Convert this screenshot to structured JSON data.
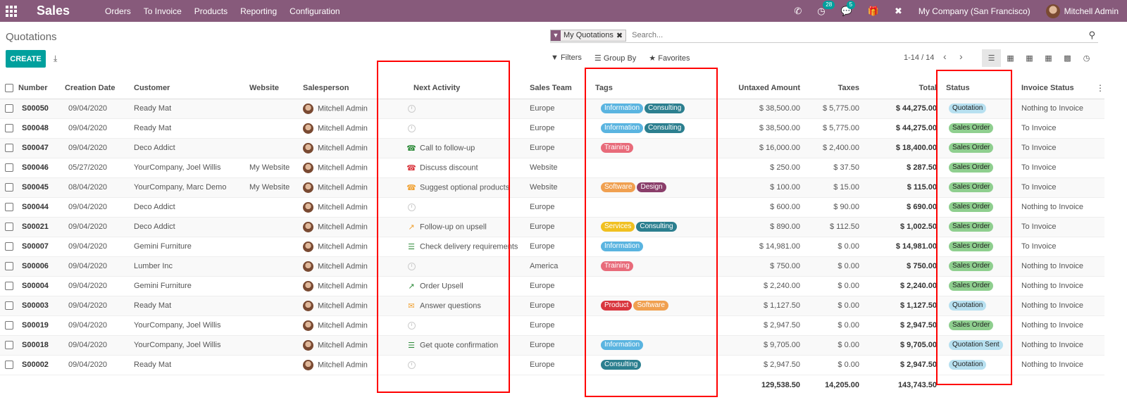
{
  "navbar": {
    "app_name": "Sales",
    "menu": [
      "Orders",
      "To Invoice",
      "Products",
      "Reporting",
      "Configuration"
    ],
    "activity_count": "28",
    "message_count": "5",
    "company": "My Company (San Francisco)",
    "user": "Mitchell Admin",
    "bg_color": "#875a7b"
  },
  "control": {
    "breadcrumb": "Quotations",
    "create_label": "CREATE",
    "facet_label": "My Quotations",
    "search_placeholder": "Search...",
    "filters_label": "Filters",
    "groupby_label": "Group By",
    "favorites_label": "Favorites",
    "pager": "1-14 / 14"
  },
  "columns": [
    "Number",
    "Creation Date",
    "Customer",
    "Website",
    "Salesperson",
    "Next Activity",
    "Sales Team",
    "Tags",
    "Untaxed Amount",
    "Taxes",
    "Total",
    "Status",
    "Invoice Status"
  ],
  "rows": [
    {
      "number": "S00050",
      "date": "09/04/2020",
      "customer": "Ready Mat",
      "website": "",
      "salesperson": "Mitchell Admin",
      "activity": "",
      "activity_icon": "clock-icon",
      "team": "Europe",
      "tags": [
        {
          "t": "Information",
          "c": "#5ab4e0"
        },
        {
          "t": "Consulting",
          "c": "#2c7f8f"
        }
      ],
      "untaxed": "$ 38,500.00",
      "taxes": "$ 5,775.00",
      "total": "$ 44,275.00",
      "status": "Quotation",
      "status_color": "#b7e0f0",
      "invoice": "Nothing to Invoice"
    },
    {
      "number": "S00048",
      "date": "09/04/2020",
      "customer": "Ready Mat",
      "website": "",
      "salesperson": "Mitchell Admin",
      "activity": "",
      "activity_icon": "clock-icon",
      "team": "Europe",
      "tags": [
        {
          "t": "Information",
          "c": "#5ab4e0"
        },
        {
          "t": "Consulting",
          "c": "#2c7f8f"
        }
      ],
      "untaxed": "$ 38,500.00",
      "taxes": "$ 5,775.00",
      "total": "$ 44,275.00",
      "status": "Sales Order",
      "status_color": "#8fcf8f",
      "invoice": "To Invoice"
    },
    {
      "number": "S00047",
      "date": "09/04/2020",
      "customer": "Deco Addict",
      "website": "",
      "salesperson": "Mitchell Admin",
      "activity": "Call to follow-up",
      "activity_icon": "phone-icon",
      "activity_color": "#2e8b3a",
      "team": "Europe",
      "tags": [
        {
          "t": "Training",
          "c": "#e86b7a"
        }
      ],
      "untaxed": "$ 16,000.00",
      "taxes": "$ 2,400.00",
      "total": "$ 18,400.00",
      "status": "Sales Order",
      "status_color": "#8fcf8f",
      "invoice": "To Invoice"
    },
    {
      "number": "S00046",
      "date": "05/27/2020",
      "customer": "YourCompany, Joel Willis",
      "website": "My Website",
      "salesperson": "Mitchell Admin",
      "activity": "Discuss discount",
      "activity_icon": "phone-icon",
      "activity_color": "#d9363e",
      "team": "Website",
      "tags": [],
      "untaxed": "$ 250.00",
      "taxes": "$ 37.50",
      "total": "$ 287.50",
      "status": "Sales Order",
      "status_color": "#8fcf8f",
      "invoice": "To Invoice"
    },
    {
      "number": "S00045",
      "date": "08/04/2020",
      "customer": "YourCompany, Marc Demo",
      "website": "My Website",
      "salesperson": "Mitchell Admin",
      "activity": "Suggest optional products",
      "activity_icon": "phone-icon",
      "activity_color": "#f0a030",
      "team": "Website",
      "tags": [
        {
          "t": "Software",
          "c": "#f0a050"
        },
        {
          "t": "Design",
          "c": "#8a3e6a"
        }
      ],
      "untaxed": "$ 100.00",
      "taxes": "$ 15.00",
      "total": "$ 115.00",
      "status": "Sales Order",
      "status_color": "#8fcf8f",
      "invoice": "To Invoice"
    },
    {
      "number": "S00044",
      "date": "09/04/2020",
      "customer": "Deco Addict",
      "website": "",
      "salesperson": "Mitchell Admin",
      "activity": "",
      "activity_icon": "clock-icon",
      "team": "Europe",
      "tags": [],
      "untaxed": "$ 600.00",
      "taxes": "$ 90.00",
      "total": "$ 690.00",
      "status": "Sales Order",
      "status_color": "#8fcf8f",
      "invoice": "Nothing to Invoice"
    },
    {
      "number": "S00021",
      "date": "09/04/2020",
      "customer": "Deco Addict",
      "website": "",
      "salesperson": "Mitchell Admin",
      "activity": "Follow-up on upsell",
      "activity_icon": "chart-icon",
      "activity_color": "#f0a030",
      "team": "Europe",
      "tags": [
        {
          "t": "Services",
          "c": "#f0c020"
        },
        {
          "t": "Consulting",
          "c": "#2c7f8f"
        }
      ],
      "untaxed": "$ 890.00",
      "taxes": "$ 112.50",
      "total": "$ 1,002.50",
      "status": "Sales Order",
      "status_color": "#8fcf8f",
      "invoice": "To Invoice"
    },
    {
      "number": "S00007",
      "date": "09/04/2020",
      "customer": "Gemini Furniture",
      "website": "",
      "salesperson": "Mitchell Admin",
      "activity": "Check delivery requirements",
      "activity_icon": "tasks-icon",
      "activity_color": "#2e8b3a",
      "team": "Europe",
      "tags": [
        {
          "t": "Information",
          "c": "#5ab4e0"
        }
      ],
      "untaxed": "$ 14,981.00",
      "taxes": "$ 0.00",
      "total": "$ 14,981.00",
      "status": "Sales Order",
      "status_color": "#8fcf8f",
      "invoice": "To Invoice"
    },
    {
      "number": "S00006",
      "date": "09/04/2020",
      "customer": "Lumber Inc",
      "website": "",
      "salesperson": "Mitchell Admin",
      "activity": "",
      "activity_icon": "clock-icon",
      "team": "America",
      "tags": [
        {
          "t": "Training",
          "c": "#e86b7a"
        }
      ],
      "untaxed": "$ 750.00",
      "taxes": "$ 0.00",
      "total": "$ 750.00",
      "status": "Sales Order",
      "status_color": "#8fcf8f",
      "invoice": "Nothing to Invoice"
    },
    {
      "number": "S00004",
      "date": "09/04/2020",
      "customer": "Gemini Furniture",
      "website": "",
      "salesperson": "Mitchell Admin",
      "activity": "Order Upsell",
      "activity_icon": "chart-icon",
      "activity_color": "#2e8b3a",
      "team": "Europe",
      "tags": [],
      "untaxed": "$ 2,240.00",
      "taxes": "$ 0.00",
      "total": "$ 2,240.00",
      "status": "Sales Order",
      "status_color": "#8fcf8f",
      "invoice": "Nothing to Invoice"
    },
    {
      "number": "S00003",
      "date": "09/04/2020",
      "customer": "Ready Mat",
      "website": "",
      "salesperson": "Mitchell Admin",
      "activity": "Answer questions",
      "activity_icon": "envelope-icon",
      "activity_color": "#f0a030",
      "team": "Europe",
      "tags": [
        {
          "t": "Product",
          "c": "#d9363e"
        },
        {
          "t": "Software",
          "c": "#f0a050"
        }
      ],
      "untaxed": "$ 1,127.50",
      "taxes": "$ 0.00",
      "total": "$ 1,127.50",
      "status": "Quotation",
      "status_color": "#b7e0f0",
      "invoice": "Nothing to Invoice"
    },
    {
      "number": "S00019",
      "date": "09/04/2020",
      "customer": "YourCompany, Joel Willis",
      "website": "",
      "salesperson": "Mitchell Admin",
      "activity": "",
      "activity_icon": "clock-icon",
      "team": "Europe",
      "tags": [],
      "untaxed": "$ 2,947.50",
      "taxes": "$ 0.00",
      "total": "$ 2,947.50",
      "status": "Sales Order",
      "status_color": "#8fcf8f",
      "invoice": "Nothing to Invoice"
    },
    {
      "number": "S00018",
      "date": "09/04/2020",
      "customer": "YourCompany, Joel Willis",
      "website": "",
      "salesperson": "Mitchell Admin",
      "activity": "Get quote confirmation",
      "activity_icon": "tasks-icon",
      "activity_color": "#2e8b3a",
      "team": "Europe",
      "tags": [
        {
          "t": "Information",
          "c": "#5ab4e0"
        }
      ],
      "untaxed": "$ 9,705.00",
      "taxes": "$ 0.00",
      "total": "$ 9,705.00",
      "status": "Quotation Sent",
      "status_color": "#b7e0f0",
      "invoice": "Nothing to Invoice"
    },
    {
      "number": "S00002",
      "date": "09/04/2020",
      "customer": "Ready Mat",
      "website": "",
      "salesperson": "Mitchell Admin",
      "activity": "",
      "activity_icon": "clock-icon",
      "team": "Europe",
      "tags": [
        {
          "t": "Consulting",
          "c": "#2c7f8f"
        }
      ],
      "untaxed": "$ 2,947.50",
      "taxes": "$ 0.00",
      "total": "$ 2,947.50",
      "status": "Quotation",
      "status_color": "#b7e0f0",
      "invoice": "Nothing to Invoice"
    }
  ],
  "totals": {
    "untaxed": "129,538.50",
    "taxes": "14,205.00",
    "total": "143,743.50"
  }
}
